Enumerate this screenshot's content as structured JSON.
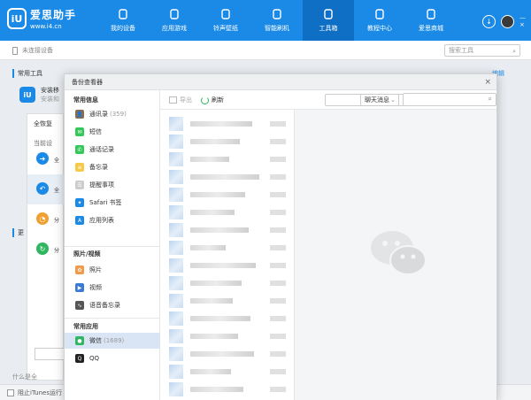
{
  "app": {
    "logo_name": "爱思助手",
    "logo_url": "www.i4.cn",
    "nav": [
      {
        "label": "我的设备",
        "icon": "phone-icon"
      },
      {
        "label": "应用游戏",
        "icon": "appstore-icon"
      },
      {
        "label": "铃声壁纸",
        "icon": "ringtone-icon"
      },
      {
        "label": "智能刷机",
        "icon": "flash-icon"
      },
      {
        "label": "工具箱",
        "icon": "toolbox-icon",
        "active": true
      },
      {
        "label": "教程中心",
        "icon": "tutorial-icon"
      },
      {
        "label": "爱思商城",
        "icon": "store-icon"
      }
    ]
  },
  "subbar": {
    "device_status": "未连接设备",
    "search_placeholder": "搜索工具"
  },
  "background": {
    "section_common": "常用工具",
    "tool_line1": "安装移",
    "tool_line2": "安装和",
    "section_more": "更"
  },
  "restore_panel": {
    "title": "全恢复",
    "subtitle": "当前设",
    "items": [
      {
        "label": "全",
        "icon": "arrow-right-icon"
      },
      {
        "label": "全",
        "icon": "arrow-left-icon"
      },
      {
        "label": "分",
        "icon": "half-circle-icon"
      },
      {
        "label": "分",
        "icon": "refresh-circle-icon"
      }
    ],
    "bottom_link": "什么是全"
  },
  "bottombar": {
    "itunes_label": "阻止iTunes运行"
  },
  "viewer": {
    "title": "备份查看器",
    "groups": {
      "common_info": "常用信息",
      "photos_videos": "照片/视频",
      "common_apps": "常用应用"
    },
    "items_info": [
      {
        "label": "通讯录",
        "count": "(359)",
        "icon": "contacts-icon",
        "color": "#8a6b4f"
      },
      {
        "label": "短信",
        "count": "",
        "icon": "sms-icon",
        "color": "#34c759"
      },
      {
        "label": "通话记录",
        "count": "",
        "icon": "call-icon",
        "color": "#34c759"
      },
      {
        "label": "备忘录",
        "count": "",
        "icon": "notes-icon",
        "color": "#f7c948"
      },
      {
        "label": "提醒事项",
        "count": "",
        "icon": "reminders-icon",
        "color": "#cccccc"
      },
      {
        "label": "Safari 书签",
        "count": "",
        "icon": "safari-icon",
        "color": "#1a8ae6"
      },
      {
        "label": "应用列表",
        "count": "",
        "icon": "applist-icon",
        "color": "#1a8ae6"
      }
    ],
    "items_media": [
      {
        "label": "照片",
        "count": "",
        "icon": "photos-icon",
        "color": "#f2994a"
      },
      {
        "label": "视频",
        "count": "",
        "icon": "video-icon",
        "color": "#3a7bd5"
      },
      {
        "label": "语音备忘录",
        "count": "",
        "icon": "voice-memo-icon",
        "color": "#555555"
      }
    ],
    "items_apps": [
      {
        "label": "微信",
        "count": "(1689)",
        "icon": "wechat-icon",
        "color": "#30b561",
        "active": true
      },
      {
        "label": "QQ",
        "count": "",
        "icon": "qq-icon",
        "color": "#222222"
      }
    ],
    "toolbar": {
      "export": "导出",
      "refresh": "刷新",
      "filter_selected": "聊天消息"
    },
    "close": "×"
  }
}
